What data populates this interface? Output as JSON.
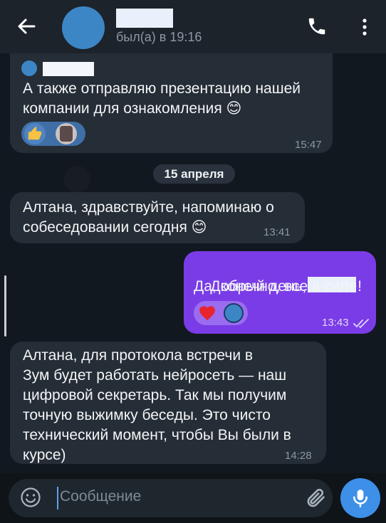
{
  "header": {
    "status": "был(а) в 19:16",
    "back_icon": "arrow-left-icon",
    "call_icon": "phone-icon",
    "more_icon": "more-vertical-icon"
  },
  "messages": [
    {
      "direction": "incoming",
      "text": "А также отправляю презентацию нашей\nкомпании для ознакомления 😊",
      "time": "15:47",
      "reactions": [
        "👍",
        "photo"
      ]
    },
    {
      "direction": "incoming",
      "text": "Алтана, здравствуйте, напоминаю о\nсобеседовании сегодня 😊",
      "time": "13:41"
    },
    {
      "direction": "outgoing",
      "text_line1_prefix": "Добрый день,",
      "text_line1_suffix": "!",
      "text_line2": "Да, конечно, все в силе",
      "time": "13:43",
      "reactions": [
        "❤",
        "avatar"
      ]
    },
    {
      "direction": "incoming",
      "text": "Алтана, для протокола встречи в\nЗум будет работать нейросеть — наш\nцифровой секретарь. Так мы получим\nточную выжимку беседы. Это чисто\nтехнический момент, чтобы Вы были в\nкурсе)",
      "time": "14:28"
    }
  ],
  "date_separator": "15 апреля",
  "input": {
    "placeholder": "Сообщение",
    "emoji_icon": "smile-icon",
    "attach_icon": "paperclip-icon",
    "mic_icon": "microphone-icon"
  },
  "colors": {
    "outgoing_bubble": "#7a3ce6",
    "incoming_bubble": "#252d36",
    "accent": "#3d8fe8"
  }
}
